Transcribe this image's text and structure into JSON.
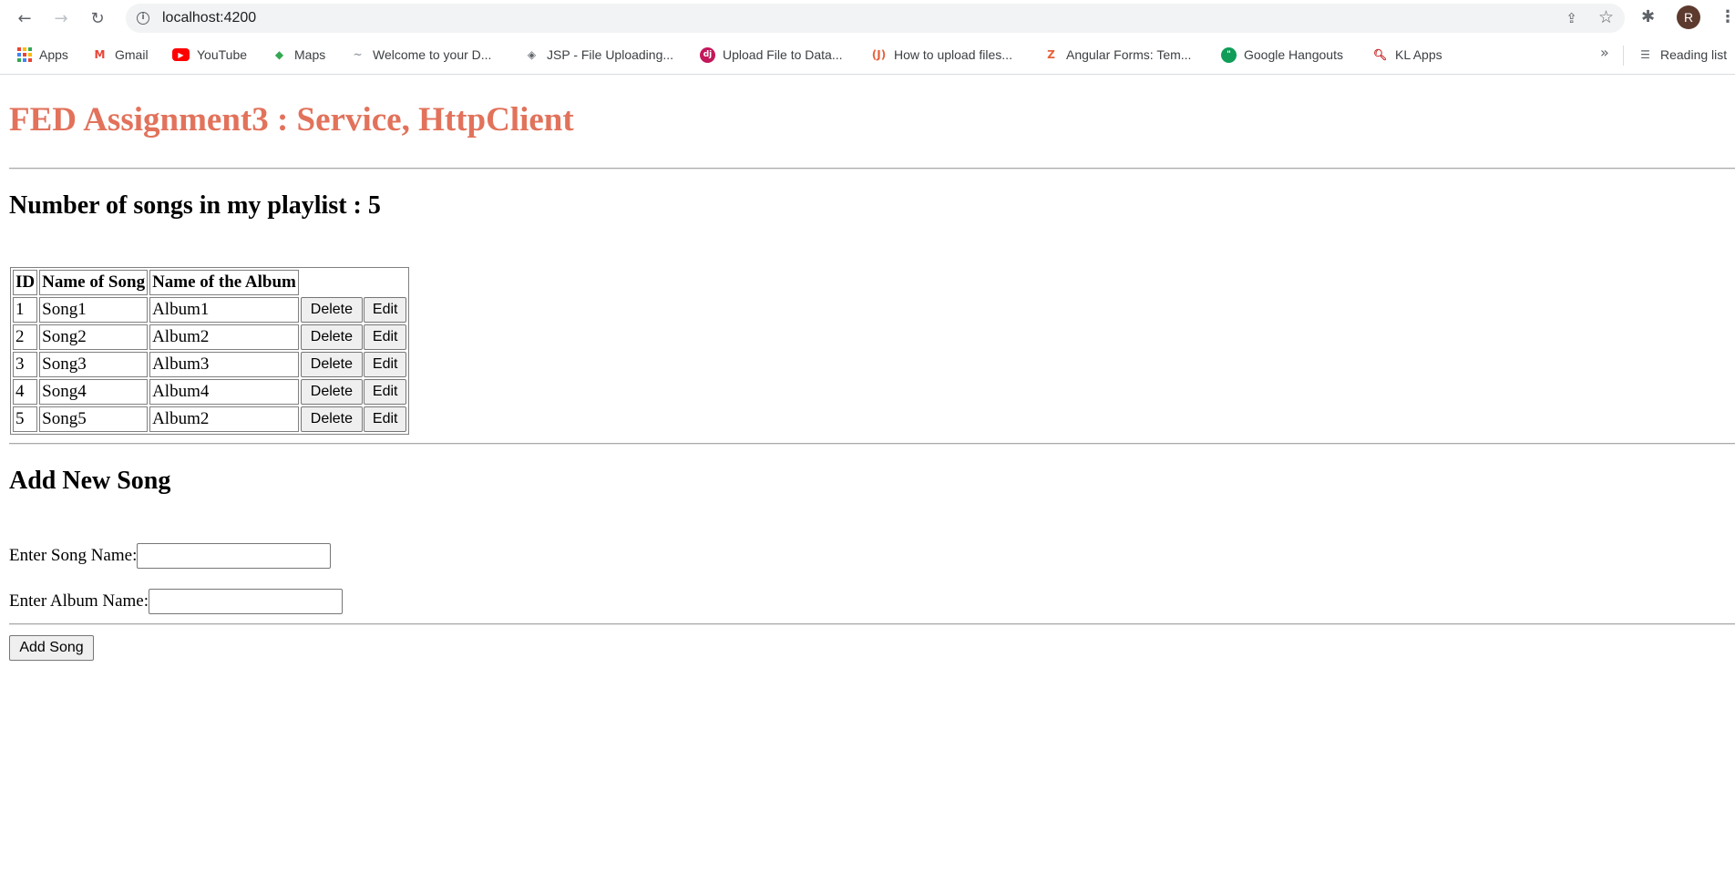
{
  "browser": {
    "url": "localhost:4200",
    "profile_initial": "R",
    "bookmarks": [
      {
        "label": "Apps",
        "icon": "apps-grid-icon"
      },
      {
        "label": "Gmail",
        "icon": "gmail-icon"
      },
      {
        "label": "YouTube",
        "icon": "youtube-icon"
      },
      {
        "label": "Maps",
        "icon": "maps-icon"
      },
      {
        "label": "Welcome to your D...",
        "icon": "welcome-icon"
      },
      {
        "label": "JSP - File Uploading...",
        "icon": "jsp-icon"
      },
      {
        "label": "Upload File to Data...",
        "icon": "upload-icon"
      },
      {
        "label": "How to upload files...",
        "icon": "howto-icon"
      },
      {
        "label": "Angular Forms: Tem...",
        "icon": "angular-icon"
      },
      {
        "label": "Google Hangouts",
        "icon": "hangouts-icon"
      },
      {
        "label": "KL Apps",
        "icon": "kl-search-icon"
      }
    ],
    "more_label": "»",
    "reading_list": "Reading list"
  },
  "page": {
    "title": "FED Assignment3 : Service, HttpClient",
    "count_label": "Number of songs in my playlist : ",
    "count_value": "5",
    "table": {
      "headers": [
        "ID",
        "Name of Song",
        "Name of the Album"
      ],
      "rows": [
        {
          "id": "1",
          "song": "Song1",
          "album": "Album1"
        },
        {
          "id": "2",
          "song": "Song2",
          "album": "Album2"
        },
        {
          "id": "3",
          "song": "Song3",
          "album": "Album3"
        },
        {
          "id": "4",
          "song": "Song4",
          "album": "Album4"
        },
        {
          "id": "5",
          "song": "Song5",
          "album": "Album2"
        }
      ],
      "delete_label": "Delete",
      "edit_label": "Edit"
    },
    "add_section": {
      "heading": "Add New Song",
      "song_label": "Enter Song Name:",
      "song_value": "",
      "album_label": "Enter Album Name:",
      "album_value": "",
      "button_label": "Add Song"
    }
  },
  "colors": {
    "title": "#e2725b"
  }
}
